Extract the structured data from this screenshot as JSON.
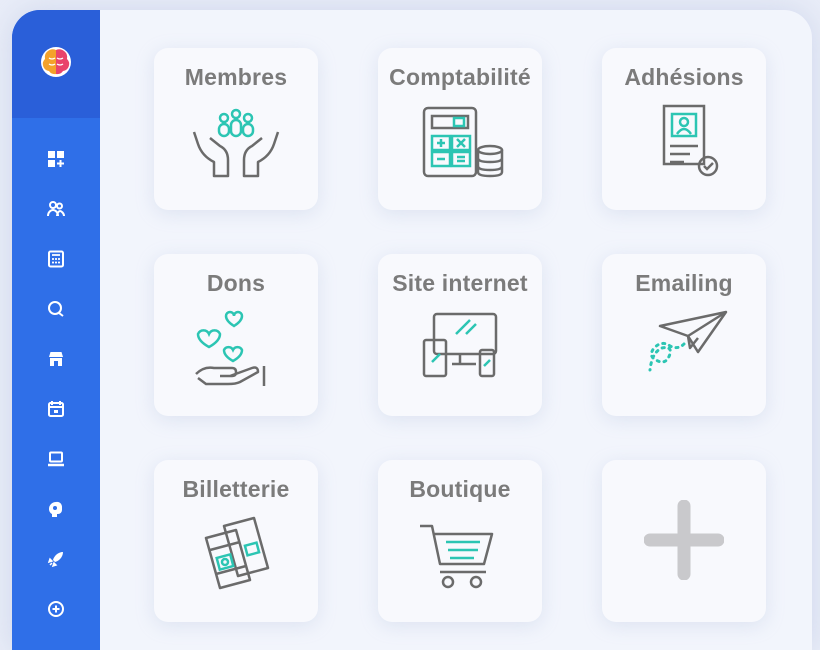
{
  "colors": {
    "sidebar": "#2f6fe8",
    "accent": "#2cc5b3",
    "icon_stroke": "#6b6b6b",
    "label": "#7b7b7b"
  },
  "sidebar": {
    "logo": "brain-logo",
    "items": [
      {
        "icon": "dashboard-add-icon"
      },
      {
        "icon": "members-icon"
      },
      {
        "icon": "calculator-icon"
      },
      {
        "icon": "chat-icon"
      },
      {
        "icon": "store-icon"
      },
      {
        "icon": "calendar-icon"
      },
      {
        "icon": "laptop-icon"
      },
      {
        "icon": "brain-icon"
      },
      {
        "icon": "rocket-icon"
      },
      {
        "icon": "add-circle-icon"
      }
    ]
  },
  "tiles": [
    {
      "label": "Membres",
      "icon": "hands-people-icon"
    },
    {
      "label": "Comptabilité",
      "icon": "calculator-coins-icon"
    },
    {
      "label": "Adhésions",
      "icon": "membership-card-icon"
    },
    {
      "label": "Dons",
      "icon": "hand-hearts-icon"
    },
    {
      "label": "Site internet",
      "icon": "devices-icon"
    },
    {
      "label": "Emailing",
      "icon": "paper-plane-icon"
    },
    {
      "label": "Billetterie",
      "icon": "tickets-icon"
    },
    {
      "label": "Boutique",
      "icon": "shopping-cart-icon"
    },
    {
      "label": "",
      "icon": "plus-icon"
    }
  ]
}
